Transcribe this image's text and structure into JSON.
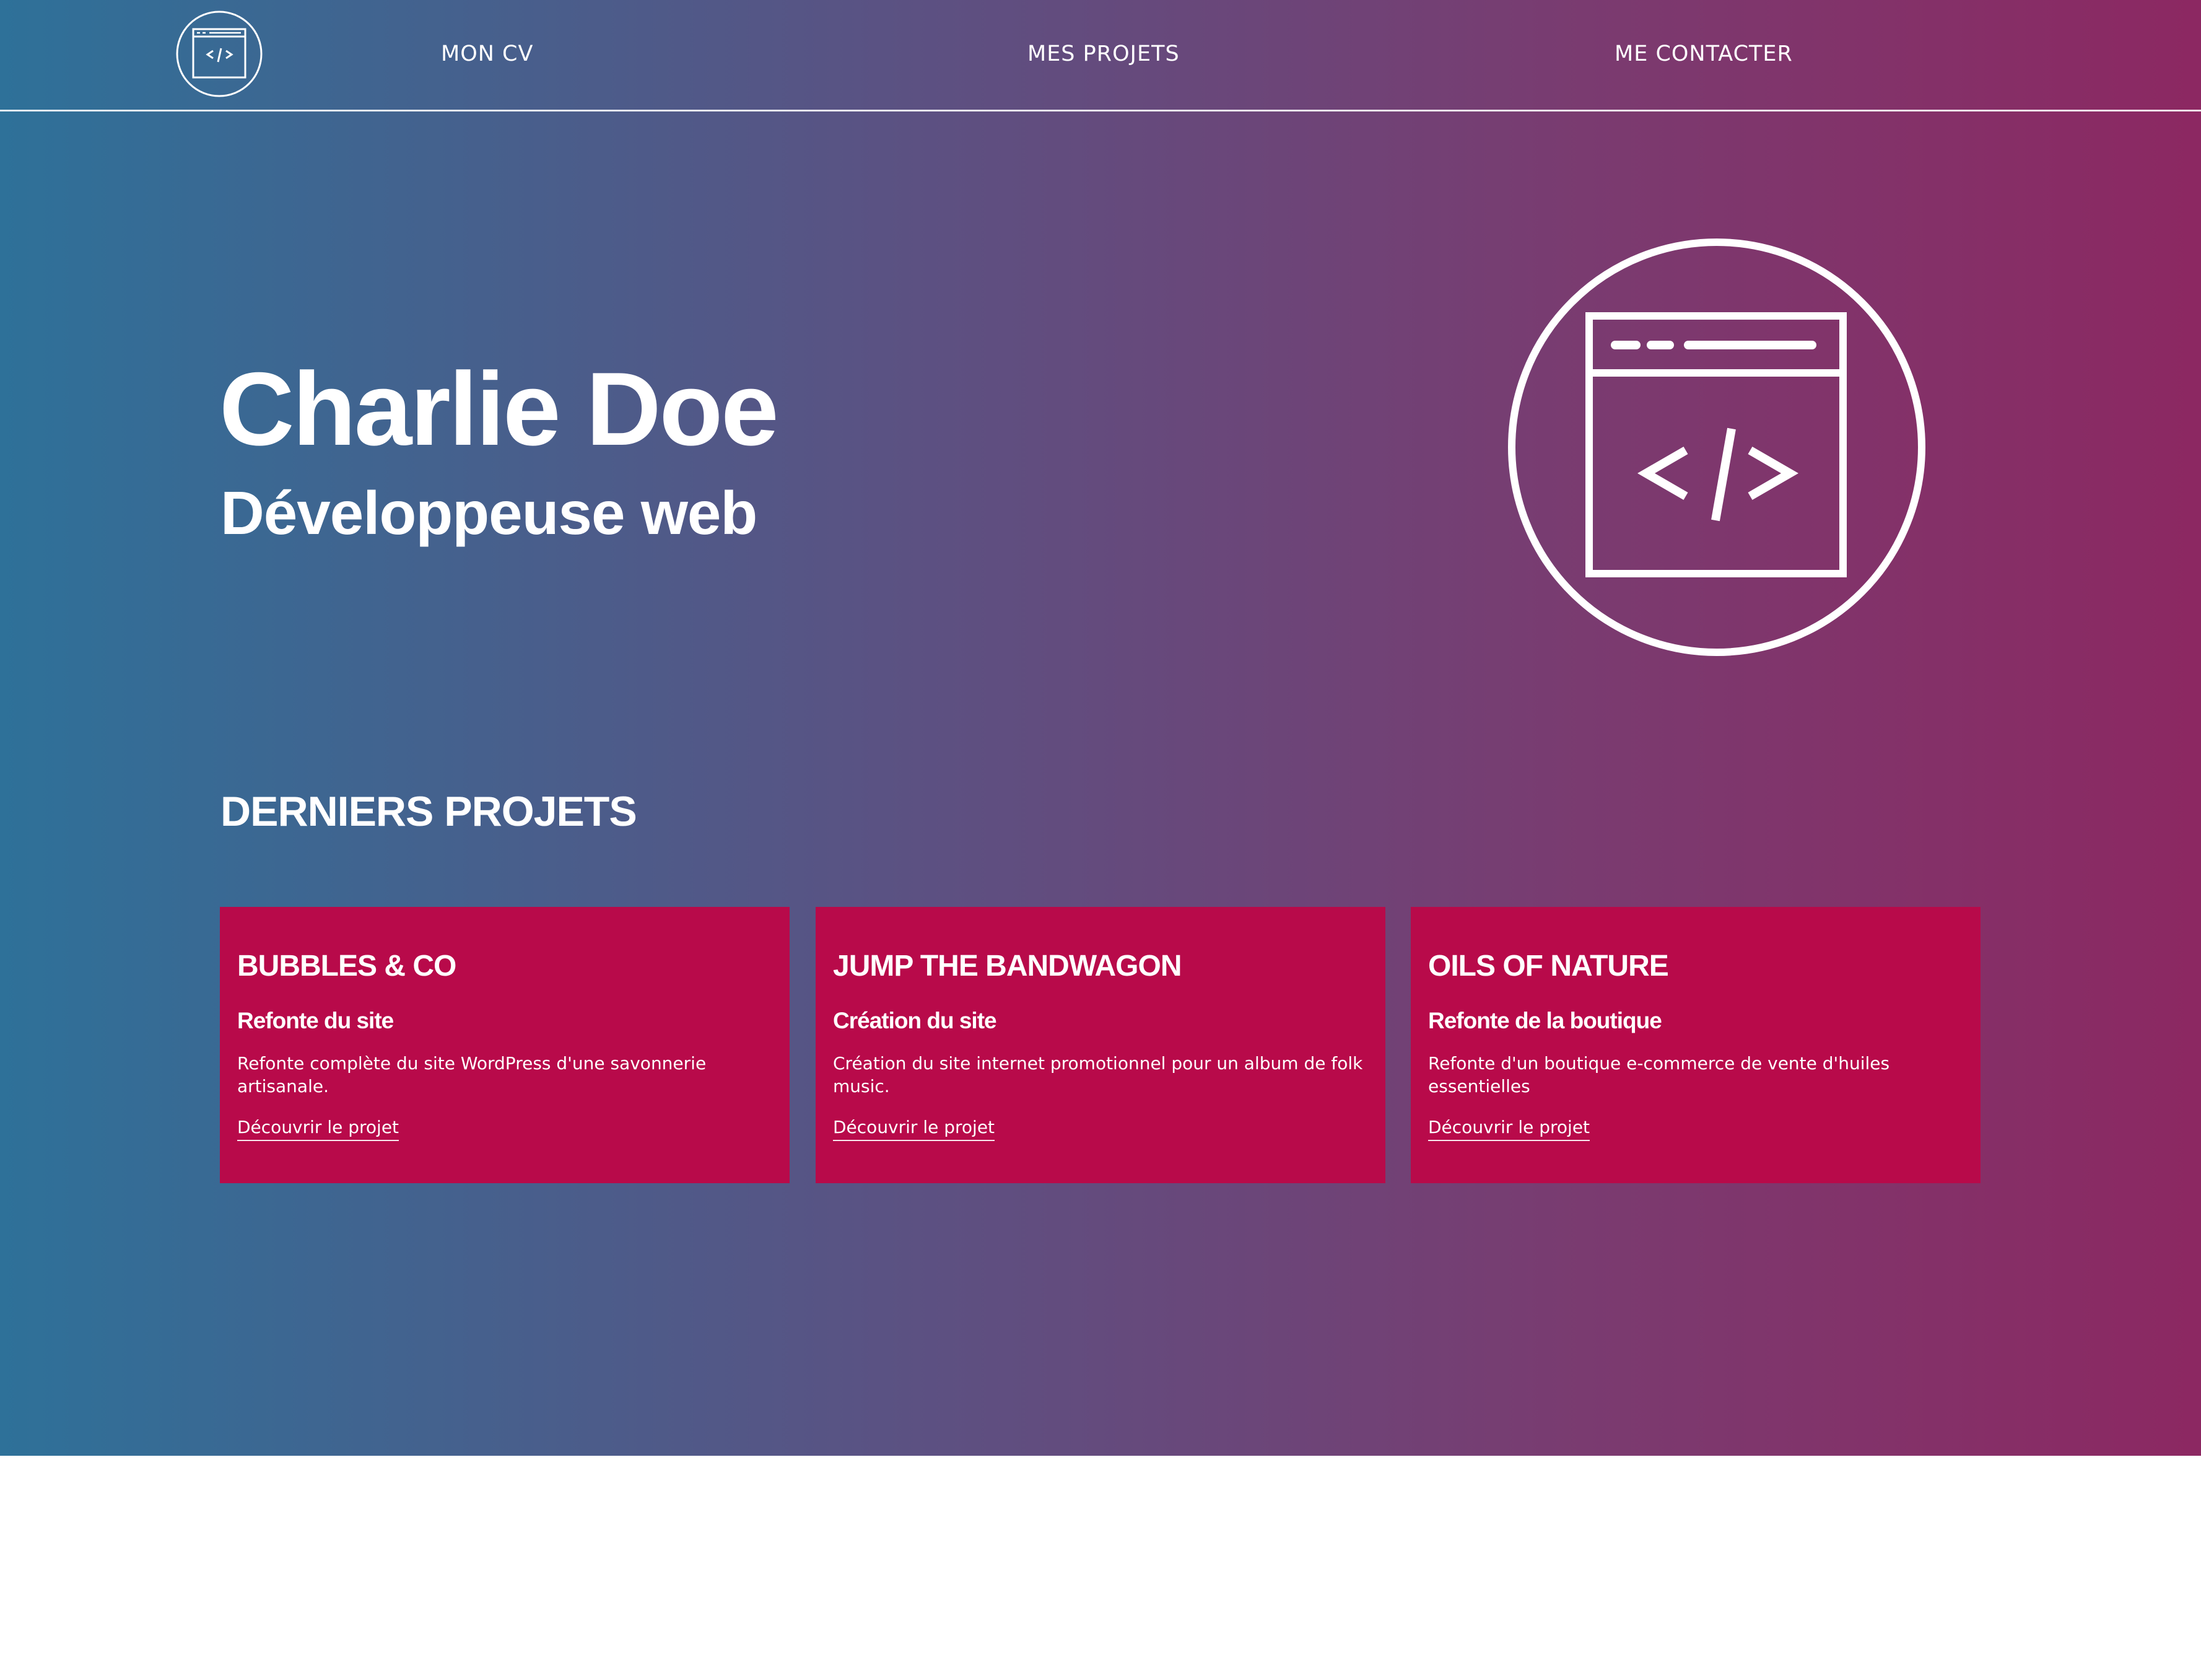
{
  "header": {
    "logo_icon": "code-window-icon",
    "nav": [
      {
        "label": "MON CV"
      },
      {
        "label": "MES PROJETS"
      },
      {
        "label": "ME CONTACTER"
      }
    ]
  },
  "hero": {
    "name": "Charlie Doe",
    "role": "Développeuse web",
    "icon": "code-window-icon"
  },
  "projects": {
    "title": "DERNIERS PROJETS",
    "items": [
      {
        "title": "BUBBLES & CO",
        "subtitle": "Refonte du site",
        "description": "Refonte complète du site WordPress d'une savonnerie artisanale.",
        "link": "Découvrir le projet"
      },
      {
        "title": "JUMP THE BANDWAGON",
        "subtitle": "Création du site",
        "description": "Création du site internet promotionnel pour un album de folk music.",
        "link": "Découvrir le projet"
      },
      {
        "title": "OILS OF NATURE",
        "subtitle": "Refonte de la boutique",
        "description": "Refonte d'un boutique e-commerce de vente d'huiles essentielles",
        "link": "Découvrir le projet"
      }
    ]
  },
  "colors": {
    "gradient_left": "#2e7199",
    "gradient_right": "#8c2862",
    "card_background": "#b80a4a",
    "text": "#ffffff"
  }
}
